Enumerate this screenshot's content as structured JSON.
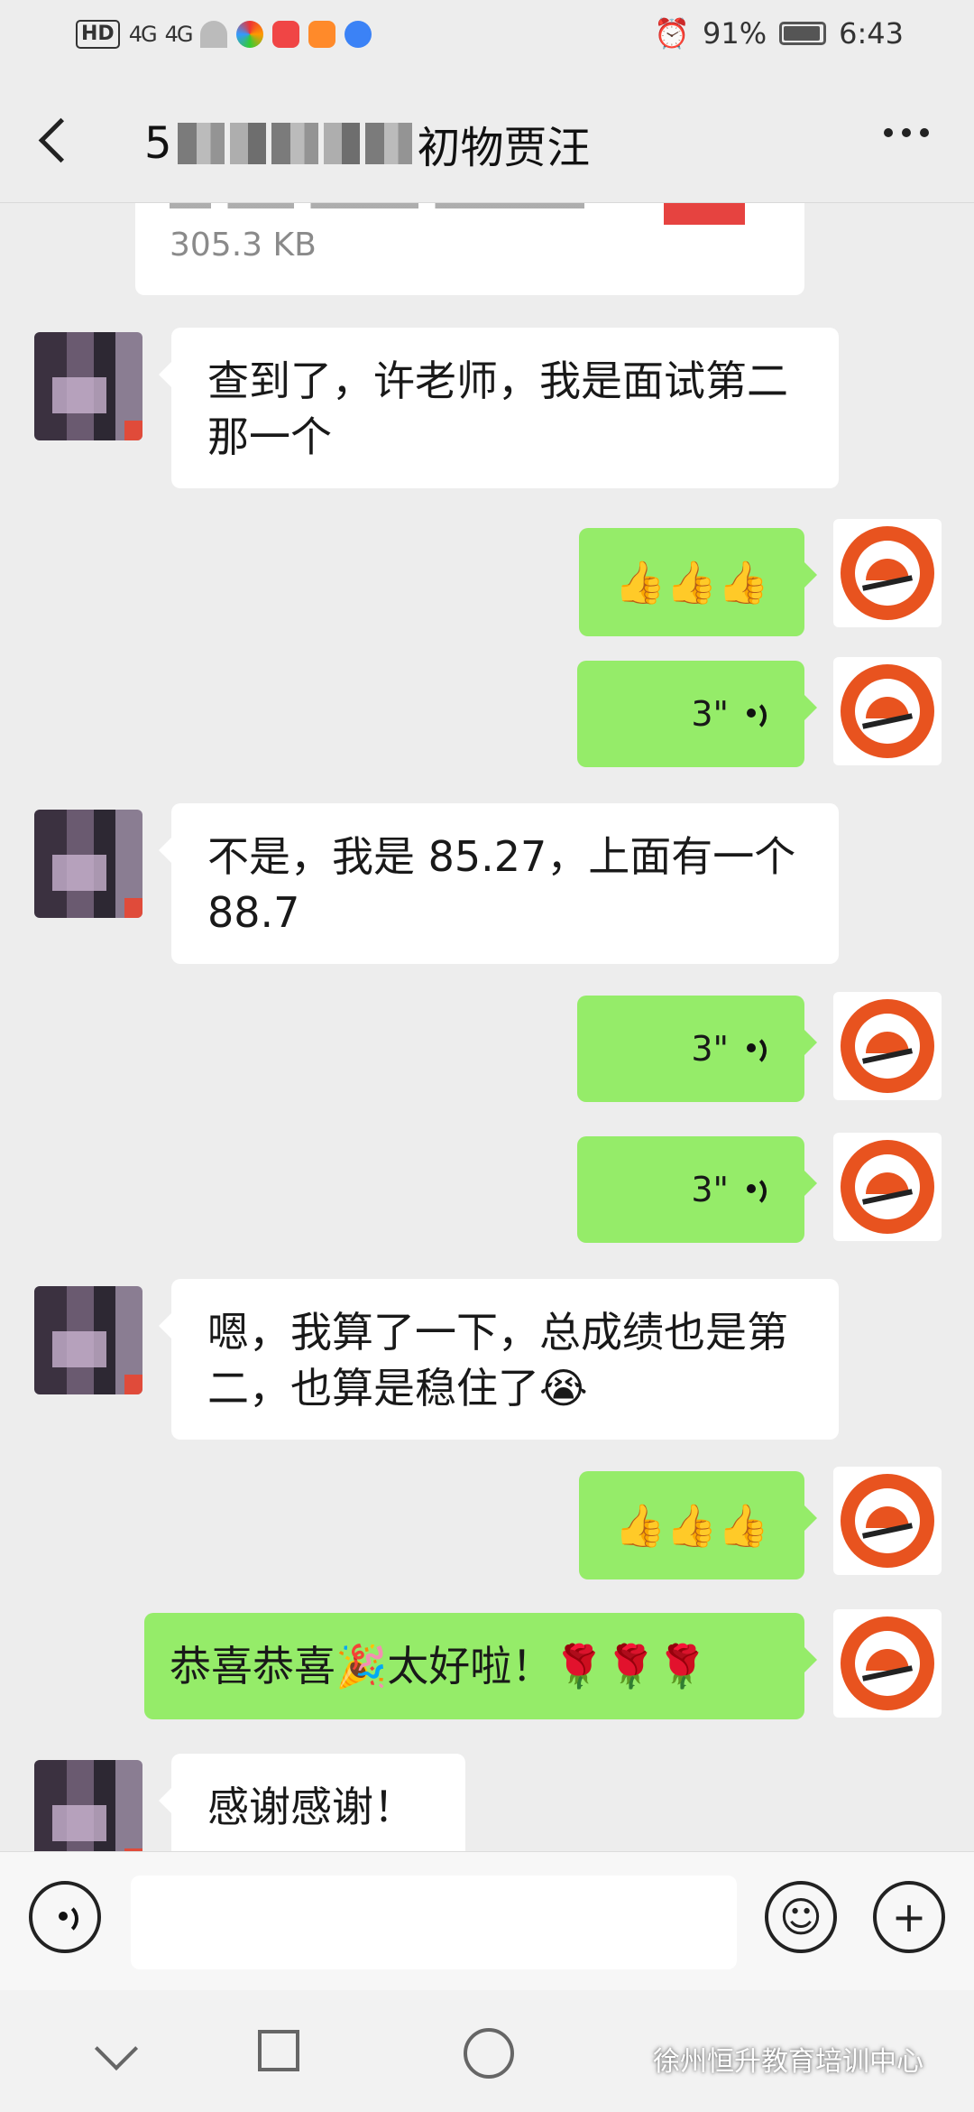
{
  "status_bar": {
    "hd_label": "HD",
    "signal_1": "4G",
    "signal_2": "4G",
    "battery_percent": "91%",
    "time": "6:43"
  },
  "header": {
    "title_visible_part": "初物贾汪",
    "title_prefix": "5"
  },
  "chat": {
    "file": {
      "size": "305.3 KB"
    },
    "messages": [
      {
        "side": "left",
        "text": "查到了，许老师，我是面试第二那一个"
      },
      {
        "side": "right",
        "type": "emoji",
        "text": "👍👍👍"
      },
      {
        "side": "right",
        "type": "voice",
        "duration": "3\""
      },
      {
        "side": "left",
        "text": "不是，我是 85.27，上面有一个 88.7"
      },
      {
        "side": "right",
        "type": "voice",
        "duration": "3\""
      },
      {
        "side": "right",
        "type": "voice",
        "duration": "3\""
      },
      {
        "side": "left",
        "text": "嗯，我算了一下，总成绩也是第二，也算是稳住了😭"
      },
      {
        "side": "right",
        "type": "emoji",
        "text": "👍👍👍"
      },
      {
        "side": "right",
        "text": "恭喜恭喜🎉太好啦！🌹🌹🌹"
      },
      {
        "side": "left",
        "text": "感谢感谢！"
      }
    ]
  },
  "input_bar": {
    "emoji_glyph": "☺",
    "plus_glyph": "+"
  },
  "watermark": "徐州恒升教育培训中心"
}
